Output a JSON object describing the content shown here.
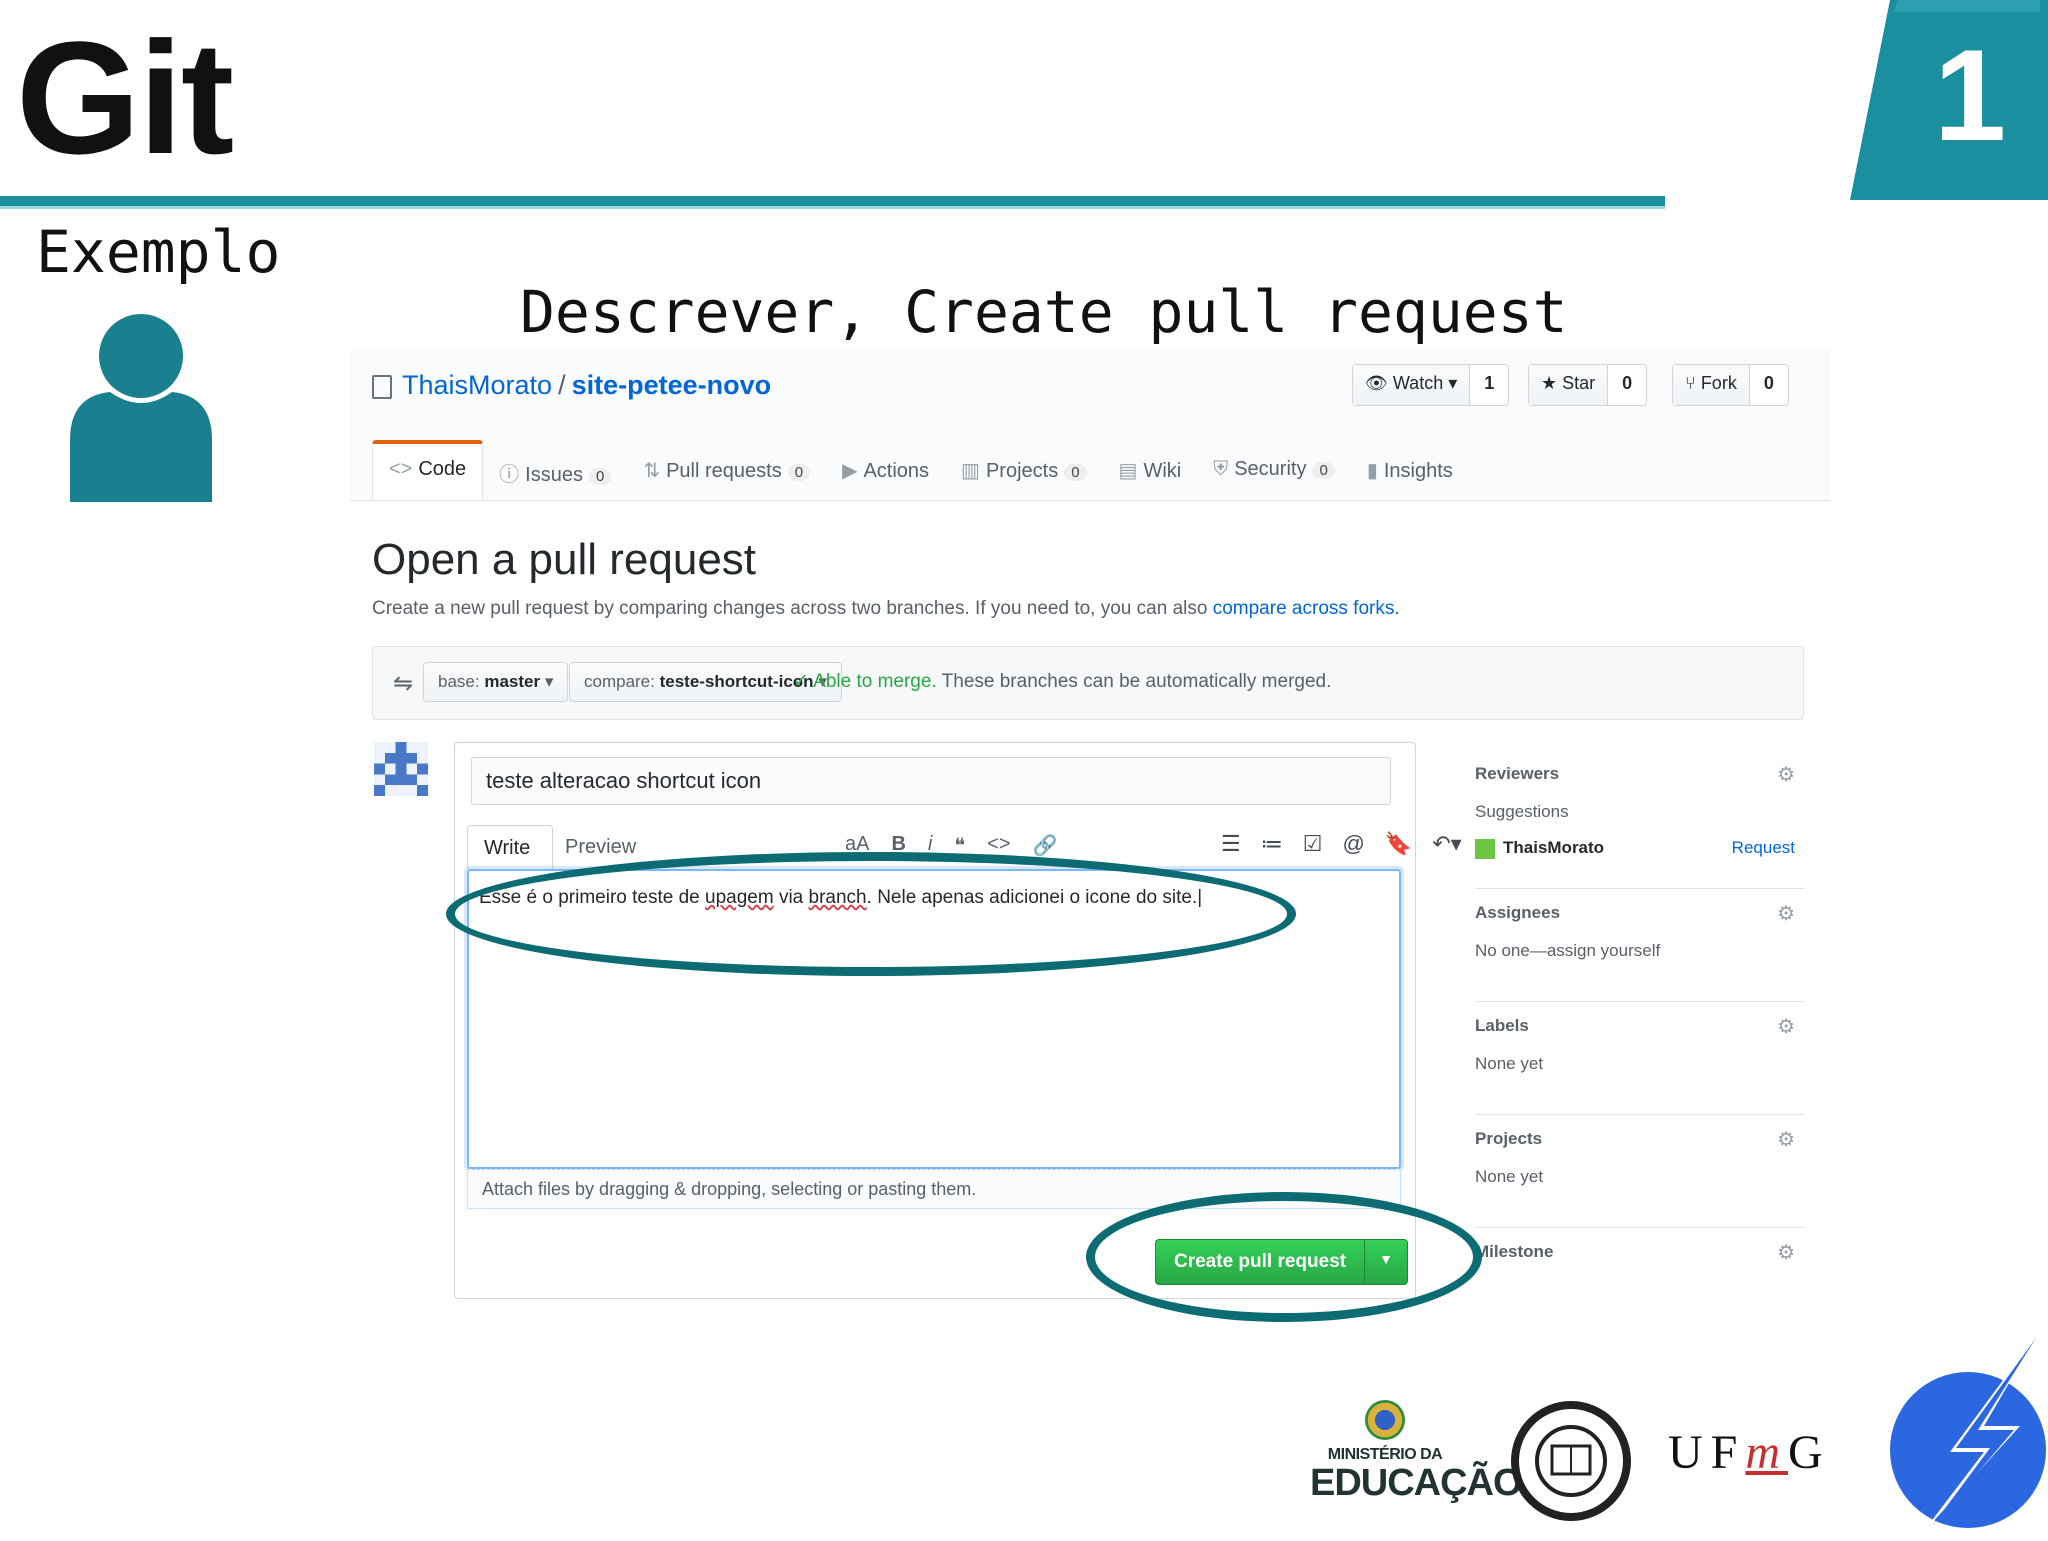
{
  "slide": {
    "title": "Git",
    "number": "1",
    "section": "Exemplo",
    "subtitle": "Descrever, Create pull request"
  },
  "repo": {
    "owner": "ThaisMorato",
    "separator": "/",
    "name": "site-petee-novo",
    "watch": {
      "label": "Watch ▾",
      "count": "1"
    },
    "star": {
      "label": "Star",
      "count": "0"
    },
    "fork": {
      "label": "Fork",
      "count": "0"
    }
  },
  "tabs": [
    {
      "icon": "<>",
      "label": "Code",
      "counter": ""
    },
    {
      "icon": "ⓘ",
      "label": "Issues",
      "counter": "0"
    },
    {
      "icon": "⇅",
      "label": "Pull requests",
      "counter": "0"
    },
    {
      "icon": "▶",
      "label": "Actions",
      "counter": ""
    },
    {
      "icon": "▥",
      "label": "Projects",
      "counter": "0"
    },
    {
      "icon": "▤",
      "label": "Wiki",
      "counter": ""
    },
    {
      "icon": "⛨",
      "label": "Security",
      "counter": "0"
    },
    {
      "icon": "▮",
      "label": "Insights",
      "counter": ""
    }
  ],
  "pr": {
    "heading": "Open a pull request",
    "description": "Create a new pull request by comparing changes across two branches. If you need to, you can also",
    "description_link": "compare across forks.",
    "base_prefix": "base:",
    "base_branch": "master",
    "compare_prefix": "compare:",
    "compare_branch": "teste-shortcut-icon",
    "merge_status": "✓ Able to merge.",
    "merge_note": "These branches can be automatically merged.",
    "title_value": "teste alteracao shortcut icon",
    "write_tab": "Write",
    "preview_tab": "Preview",
    "body_before": "Esse é o primeiro teste de ",
    "body_sq1": "upagem",
    "body_mid": " via ",
    "body_sq2": "branch",
    "body_after": ". Nele apenas adicionei o icone do site.",
    "attach_hint": "Attach files by dragging & dropping, selecting or pasting them.",
    "create_label": "Create pull request"
  },
  "sidebar": {
    "reviewers": {
      "heading": "Reviewers",
      "value": "Suggestions",
      "suggested_user": "ThaisMorato",
      "request": "Request"
    },
    "assignees": {
      "heading": "Assignees",
      "value": "No one—assign yourself"
    },
    "labels": {
      "heading": "Labels",
      "value": "None yet"
    },
    "projects": {
      "heading": "Projects",
      "value": "None yet"
    },
    "milestone": {
      "heading": "Milestone"
    }
  },
  "footer": {
    "mec_line1": "MINISTÉRIO DA",
    "mec_line2": "EDUCAÇÃO",
    "ufmg_u": "UF",
    "ufmg_m": "m",
    "ufmg_g": "G"
  },
  "colors": {
    "accent": "#1a8fa0",
    "highlight": "#0d6b73",
    "button_green": "#28a745",
    "link": "#0366d6"
  }
}
